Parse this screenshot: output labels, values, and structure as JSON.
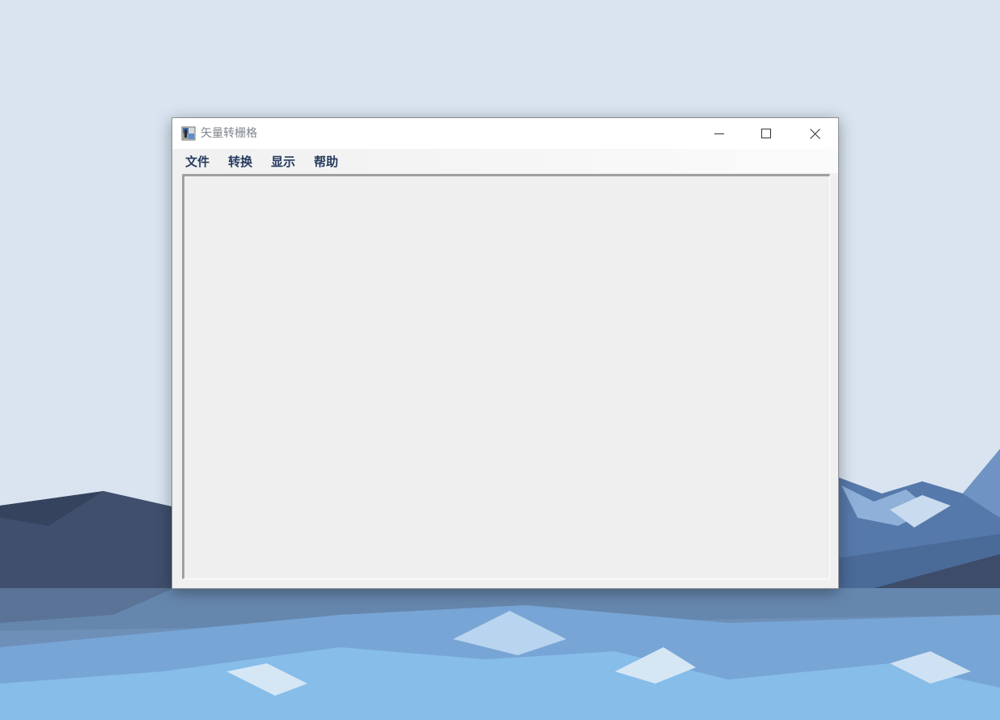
{
  "window": {
    "title": "矢量转栅格",
    "app_icon": "raster-app-icon"
  },
  "title_controls": {
    "minimize": "minimize-icon",
    "maximize": "maximize-icon",
    "close": "close-icon"
  },
  "menu": {
    "items": [
      {
        "label": "文件"
      },
      {
        "label": "转换"
      },
      {
        "label": "显示"
      },
      {
        "label": "帮助"
      }
    ]
  },
  "colors": {
    "sky": "#d9e4f0",
    "menu_text": "#253a5e",
    "title_text": "#7d848c",
    "canvas": "#efefef"
  }
}
